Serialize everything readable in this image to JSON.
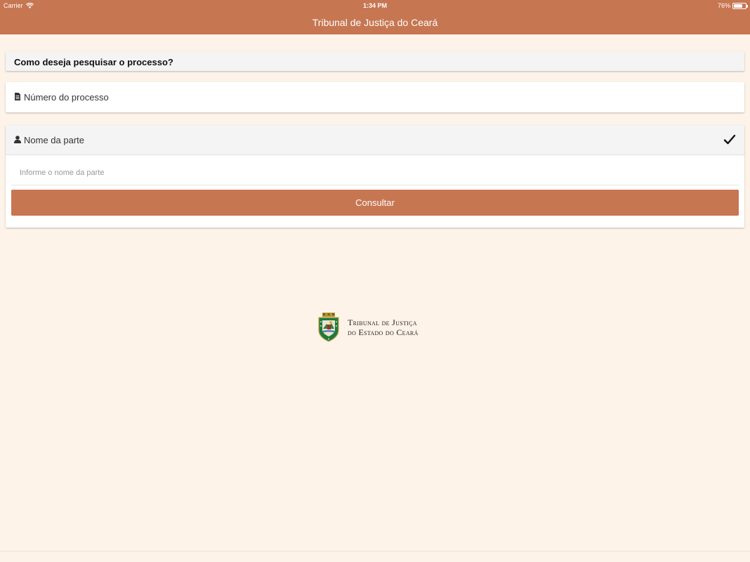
{
  "status_bar": {
    "carrier": "Carrier",
    "time": "1:34 PM",
    "battery": "76%",
    "battery_level": 0.76
  },
  "header": {
    "title": "Tribunal de Justiça do Ceará",
    "background": "#c77652"
  },
  "search": {
    "question": "Como deseja pesquisar o processo?",
    "option_number": {
      "label": "Número do processo",
      "icon": "document-icon"
    },
    "option_name": {
      "label": "Nome da parte",
      "icon": "person-icon",
      "selected": true,
      "input_placeholder": "Informe o nome da parte",
      "input_value": "",
      "submit_label": "Consultar"
    }
  },
  "logo": {
    "line1": "Tribunal de Justiça",
    "line2": "do Estado do Ceará"
  },
  "colors": {
    "accent": "#c77652",
    "page_background": "#fdf3e9"
  }
}
